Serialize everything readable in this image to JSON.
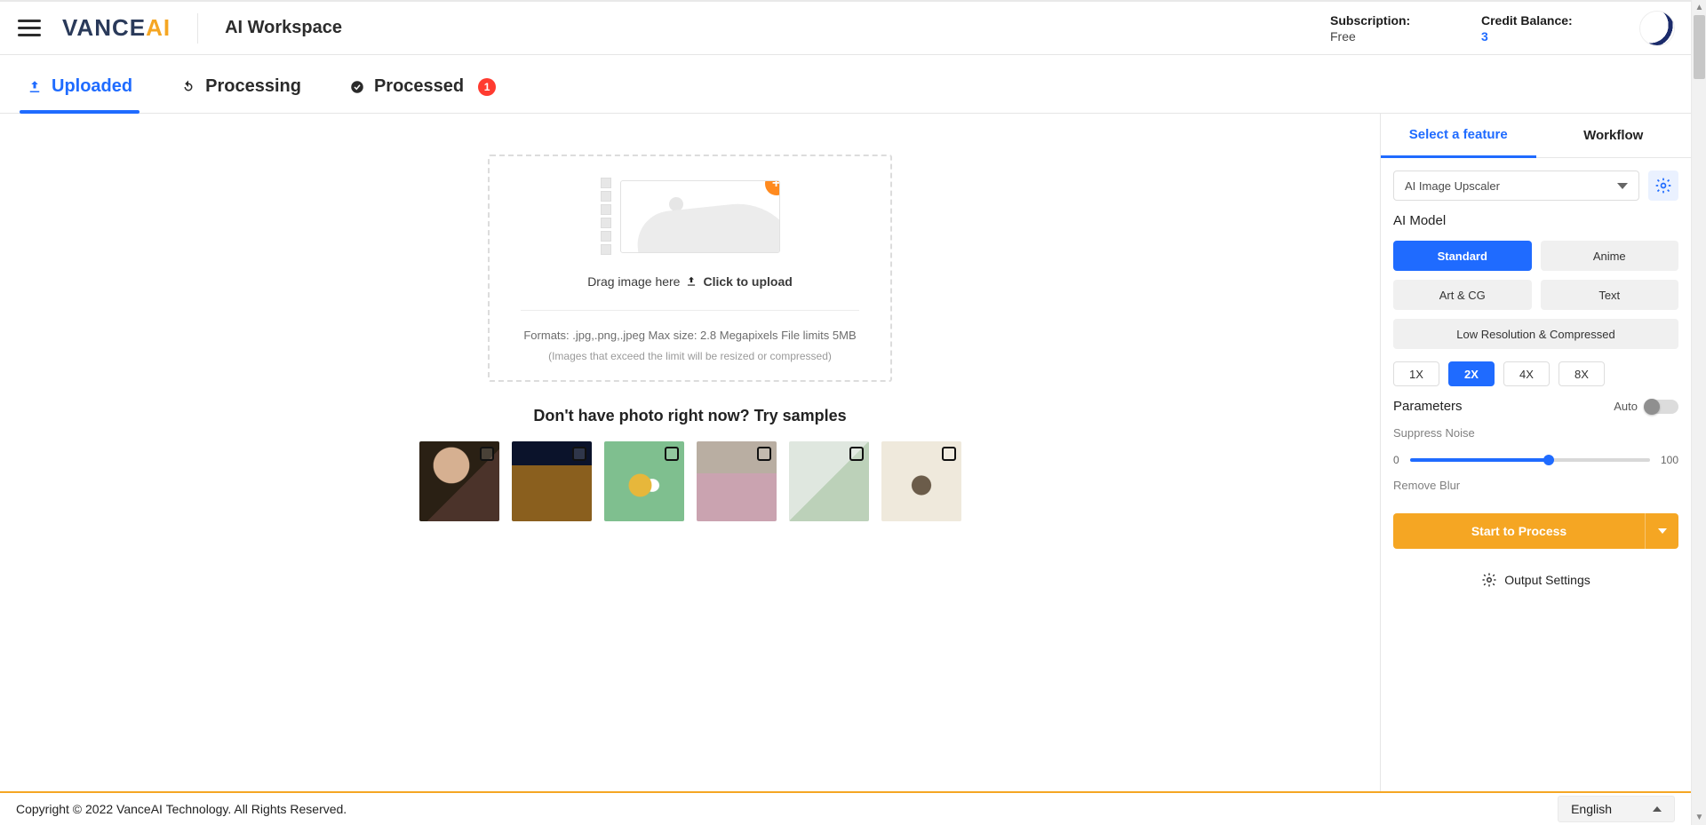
{
  "header": {
    "logo_left": "VANCE",
    "logo_right": "AI",
    "title": "AI Workspace",
    "subscription_label": "Subscription:",
    "subscription_value": "Free",
    "credit_label": "Credit Balance:",
    "credit_value": "3"
  },
  "tabs": {
    "uploaded": "Uploaded",
    "processing": "Processing",
    "processed": "Processed",
    "processed_badge": "1"
  },
  "dropzone": {
    "drag_text": "Drag image here ",
    "click_text": "Click to upload",
    "formats": "Formats: .jpg,.png,.jpeg Max size: 2.8 Megapixels File limits 5MB",
    "resize_note": "(Images that exceed the limit will be resized or compressed)"
  },
  "samples_title": "Don't have photo right now? Try samples",
  "sidebar": {
    "tab_feature": "Select a feature",
    "tab_workflow": "Workflow",
    "feature_select": "AI Image Upscaler",
    "ai_model_label": "AI Model",
    "models": {
      "standard": "Standard",
      "anime": "Anime",
      "artcg": "Art & CG",
      "text": "Text",
      "lowres": "Low Resolution & Compressed"
    },
    "scales": {
      "x1": "1X",
      "x2": "2X",
      "x4": "4X",
      "x8": "8X"
    },
    "parameters_label": "Parameters",
    "auto_label": "Auto",
    "suppress_label": "Suppress Noise",
    "suppress_min": "0",
    "suppress_max": "100",
    "remove_blur_label": "Remove Blur",
    "process_btn": "Start to Process",
    "output_settings": "Output Settings"
  },
  "footer": {
    "copyright": "Copyright © 2022 VanceAI Technology. All Rights Reserved.",
    "language": "English"
  }
}
